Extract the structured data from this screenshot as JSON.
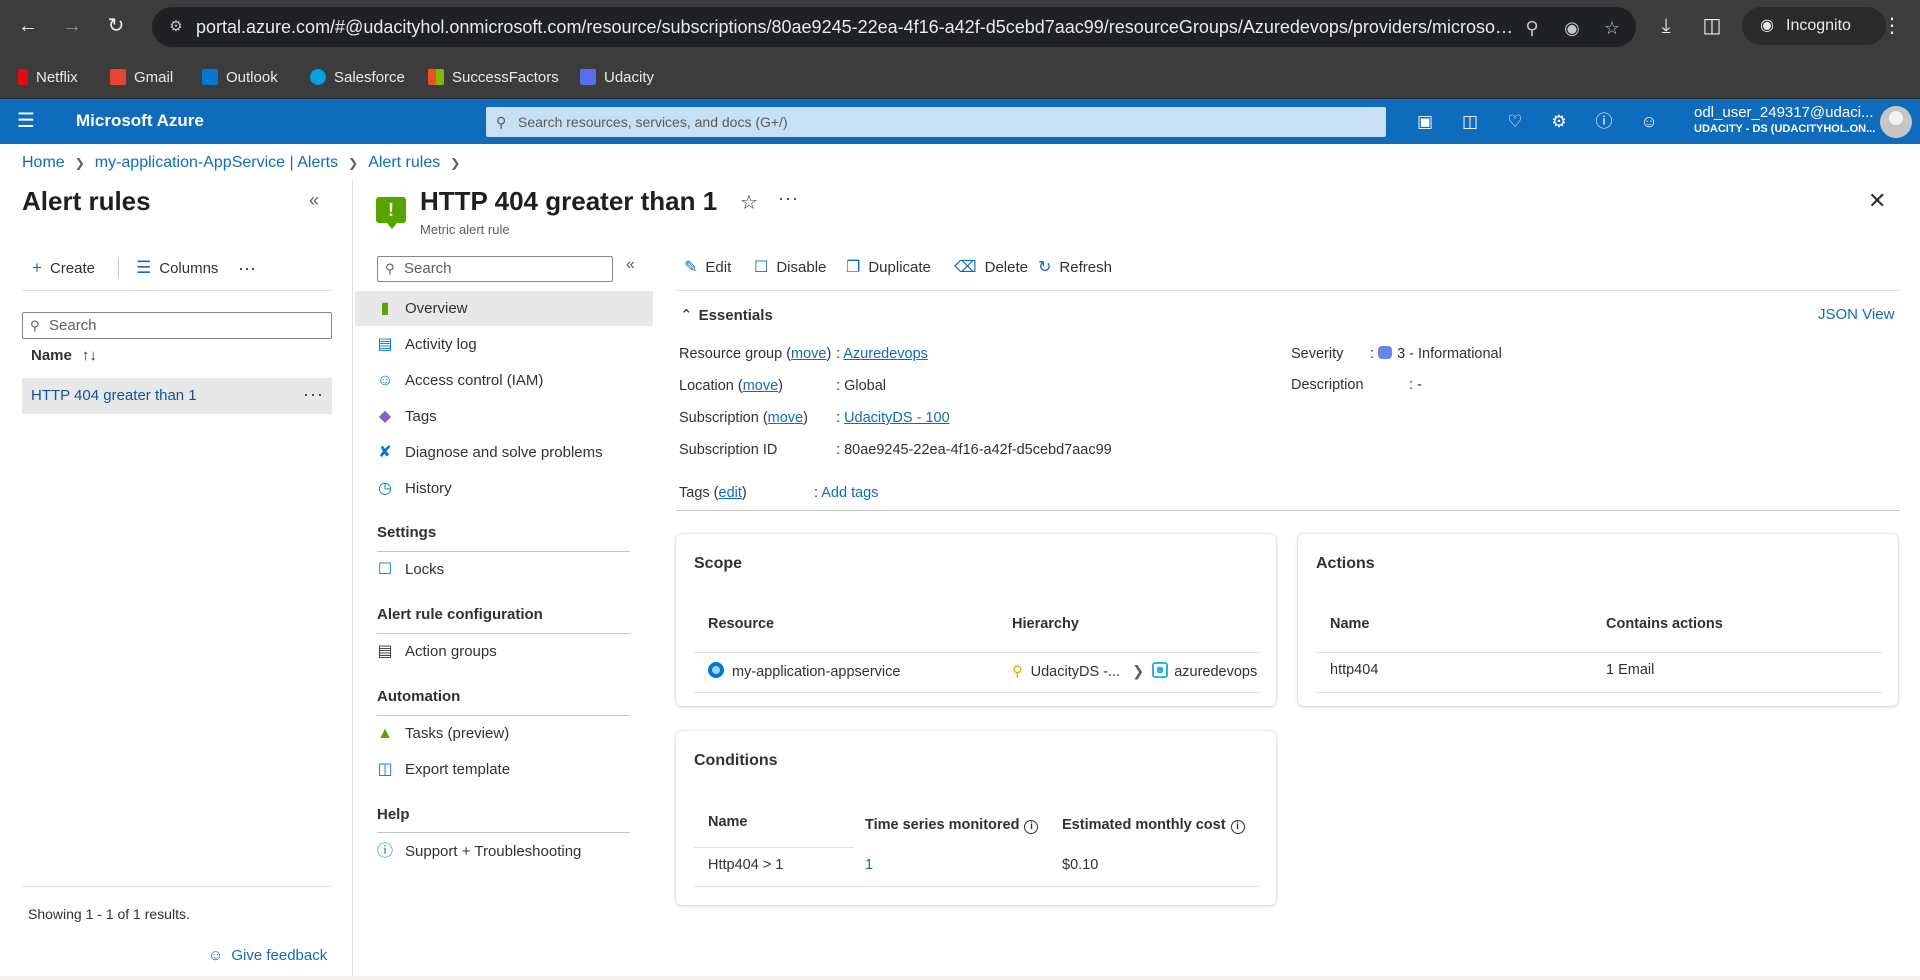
{
  "browser": {
    "url": "portal.azure.com/#@udacityhol.onmicrosoft.com/resource/subscriptions/80ae9245-22ea-4f16-a42f-d5cebd7aac99/resourceGroups/Azuredevops/providers/microsoft.in...",
    "incognito_label": "Incognito",
    "bookmarks": [
      {
        "label": "Netflix",
        "color": "#e50914"
      },
      {
        "label": "Gmail",
        "color": "#ea4335"
      },
      {
        "label": "Outlook",
        "color": "#0078d4"
      },
      {
        "label": "Salesforce",
        "color": "#00a1e0"
      },
      {
        "label": "SuccessFactors",
        "color": "#f25022"
      },
      {
        "label": "Udacity",
        "color": "#5a6ff0"
      }
    ]
  },
  "portal": {
    "brand": "Microsoft Azure",
    "search_placeholder": "Search resources, services, and docs (G+/)",
    "user_name": "odl_user_249317@udaci...",
    "user_tenant": "UDACITY - DS (UDACITYHOL.ON..."
  },
  "breadcrumb": [
    "Home",
    "my-application-AppService | Alerts",
    "Alert rules"
  ],
  "left_pane": {
    "title": "Alert rules",
    "create_label": "Create",
    "columns_label": "Columns",
    "search_placeholder": "Search",
    "name_header": "Name",
    "rules": [
      "HTTP 404 greater than 1"
    ],
    "showing": "Showing 1 - 1 of 1 results.",
    "feedback": "Give feedback"
  },
  "resource": {
    "title": "HTTP 404 greater than 1",
    "subtitle": "Metric alert rule",
    "menu_search_placeholder": "Search",
    "menu": {
      "overview": "Overview",
      "activity_log": "Activity log",
      "iam": "Access control (IAM)",
      "tags": "Tags",
      "diagnose": "Diagnose and solve problems",
      "history": "History",
      "settings": "Settings",
      "locks": "Locks",
      "alert_rule_config": "Alert rule configuration",
      "action_groups": "Action groups",
      "automation": "Automation",
      "tasks": "Tasks (preview)",
      "export_template": "Export template",
      "help": "Help",
      "support": "Support + Troubleshooting"
    },
    "commands": {
      "edit": "Edit",
      "disable": "Disable",
      "duplicate": "Duplicate",
      "delete": "Delete",
      "refresh": "Refresh"
    }
  },
  "essentials": {
    "heading": "Essentials",
    "json_view": "JSON View",
    "resource_group_label": "Resource group",
    "move_label": "move",
    "resource_group_value": "Azuredevops",
    "location_label": "Location",
    "location_value": "Global",
    "subscription_label": "Subscription",
    "subscription_value": "UdacityDS - 100",
    "subscription_id_label": "Subscription ID",
    "subscription_id_value": "80ae9245-22ea-4f16-a42f-d5cebd7aac99",
    "tags_label": "Tags",
    "edit_label": "edit",
    "tags_value": "Add tags",
    "severity_label": "Severity",
    "severity_value": "3 - Informational",
    "description_label": "Description",
    "description_value": "-"
  },
  "scope": {
    "title": "Scope",
    "col_resource": "Resource",
    "col_hierarchy": "Hierarchy",
    "resource": "my-application-appservice",
    "hierarchy_sub": "UdacityDS -...",
    "hierarchy_rg": "azuredevops"
  },
  "actions": {
    "title": "Actions",
    "col_name": "Name",
    "col_contains": "Contains actions",
    "name": "http404",
    "contains": "1 Email"
  },
  "conditions": {
    "title": "Conditions",
    "col_name": "Name",
    "col_series": "Time series monitored",
    "col_cost": "Estimated monthly cost",
    "name": "Http404 > 1",
    "series": "1",
    "cost": "$0.10"
  }
}
